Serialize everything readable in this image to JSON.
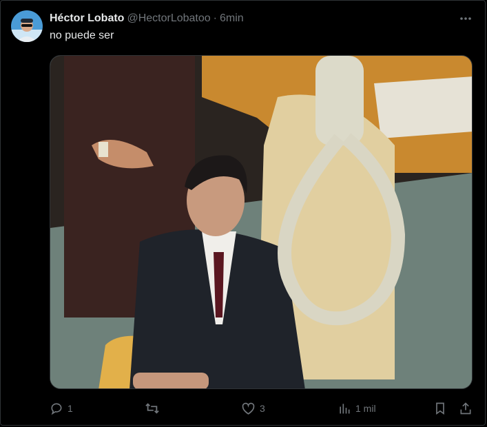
{
  "post": {
    "author_name": "Héctor Lobato",
    "author_handle": "@HectorLobatoo",
    "separator": "·",
    "time": "6min",
    "text": "no puede ser",
    "stats": {
      "replies": "1",
      "reposts": "",
      "likes": "3",
      "views": "1 mil"
    }
  },
  "icons": {
    "avatar": "avatar-photo",
    "more": "more-dots-icon",
    "reply": "reply-bubble-icon",
    "repost": "repost-arrows-icon",
    "like": "heart-icon",
    "views": "bar-chart-icon",
    "bookmark": "bookmark-icon",
    "share": "share-upload-icon"
  },
  "colors": {
    "background": "#000000",
    "text_primary": "#e7e9ea",
    "text_secondary": "#71767b",
    "border": "#2f3336"
  }
}
